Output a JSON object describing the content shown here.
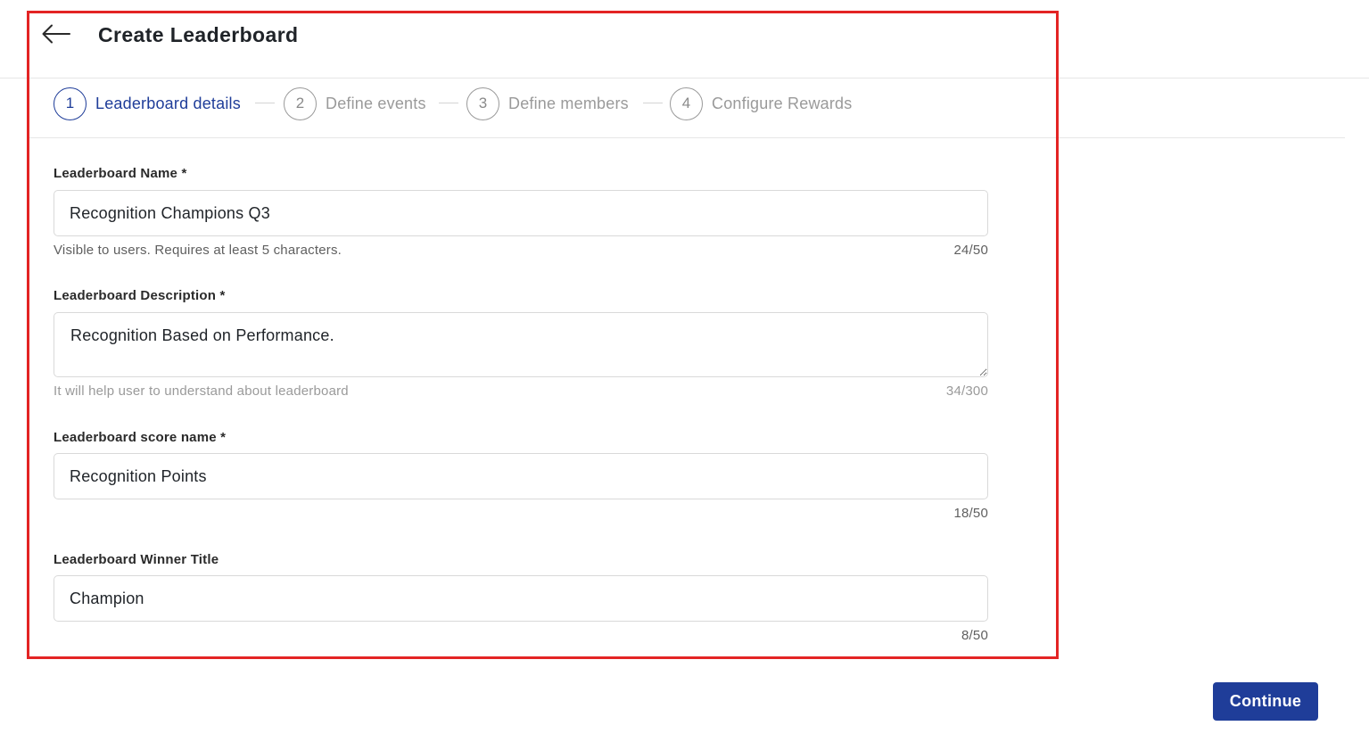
{
  "header": {
    "back_icon": "arrow-left-icon",
    "title": "Create Leaderboard"
  },
  "stepper": {
    "steps": [
      {
        "number": "1",
        "label": "Leaderboard details",
        "active": true
      },
      {
        "number": "2",
        "label": "Define events",
        "active": false
      },
      {
        "number": "3",
        "label": "Define members",
        "active": false
      },
      {
        "number": "4",
        "label": "Configure Rewards",
        "active": false
      }
    ]
  },
  "form": {
    "name": {
      "label": "Leaderboard Name *",
      "value": "Recognition Champions Q3",
      "helper": "Visible to users. Requires at least 5 characters.",
      "counter": "24/50"
    },
    "description": {
      "label": "Leaderboard Description *",
      "value": "Recognition Based on Performance.",
      "helper": "It will help user to understand about leaderboard",
      "counter": "34/300"
    },
    "score_name": {
      "label": "Leaderboard score name *",
      "value": "Recognition Points",
      "counter": "18/50"
    },
    "winner_title": {
      "label": "Leaderboard Winner Title",
      "value": "Champion",
      "counter": "8/50"
    }
  },
  "actions": {
    "continue_label": "Continue"
  },
  "colors": {
    "primary": "#1f3d99",
    "highlight": "#e32424",
    "border": "#d9d9d9",
    "muted": "#9a9a9a"
  }
}
